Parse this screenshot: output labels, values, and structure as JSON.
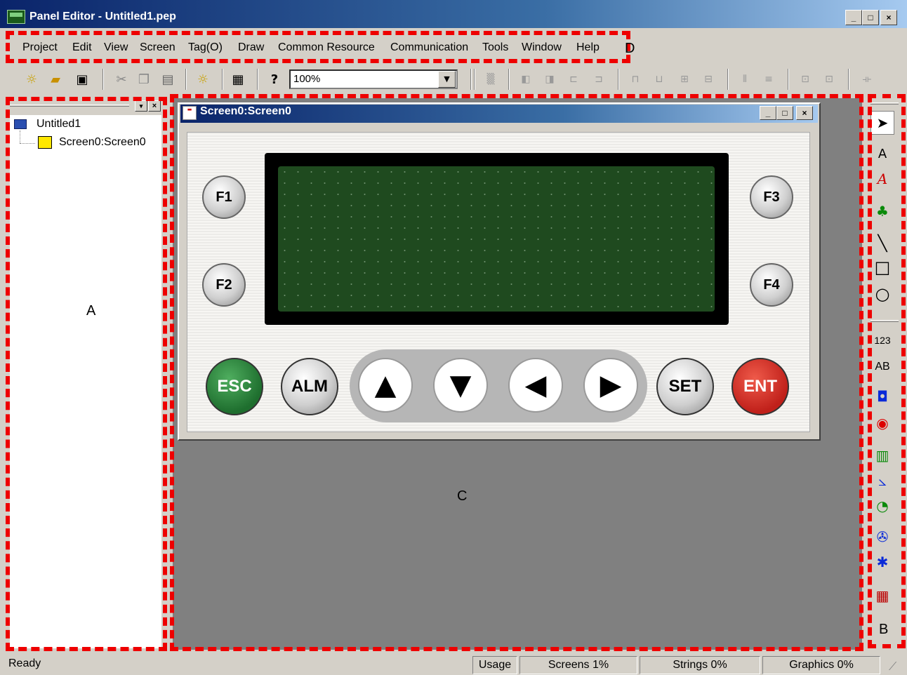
{
  "window": {
    "title": "Panel Editor - Untitled1.pep",
    "min": "_",
    "max": "□",
    "close": "×"
  },
  "menu": [
    "Project",
    "Edit",
    "View",
    "Screen",
    "Tag(O)",
    "Draw",
    "Common Resource",
    "Communication",
    "Tools",
    "Window",
    "Help"
  ],
  "toolbar": {
    "zoom": "100%",
    "icons": [
      "new-icon",
      "open-icon",
      "save-icon",
      "cut-icon",
      "copy-icon",
      "paste-icon",
      "new-screen-icon",
      "print-icon",
      "help-icon",
      "grid-icon",
      "bring-front-icon",
      "send-back-icon",
      "align-left-icon",
      "align-right-icon",
      "align-top-icon",
      "align-bottom-icon",
      "align-vcenter-icon",
      "align-hcenter-icon",
      "space-horizontal-icon",
      "space-vertical-icon",
      "center-horizontal-icon",
      "center-vertical-icon",
      "same-width-icon"
    ]
  },
  "tree": {
    "root": "Untitled1",
    "child": "Screen0:Screen0"
  },
  "child_window": {
    "title": "Screen0:Screen0"
  },
  "panel": {
    "fkeys": [
      "F1",
      "F2",
      "F3",
      "F4"
    ],
    "buttons": {
      "esc": "ESC",
      "alm": "ALM",
      "set": "SET",
      "ent": "ENT"
    },
    "arrows": {
      "up": "▲",
      "down": "▼",
      "left": "◀",
      "right": "▶"
    }
  },
  "toolbox": {
    "group1": [
      "pointer-icon",
      "text-icon",
      "italic-text-icon",
      "bitmap-icon",
      "line-icon",
      "rectangle-icon",
      "circle-icon"
    ],
    "group2_labels": {
      "numeric": "123",
      "text_display": "AB"
    },
    "group2": [
      "numeric-display-icon",
      "text-display-icon",
      "button-icon",
      "lamp-icon",
      "bar-graph-icon",
      "trend-icon",
      "pie-icon",
      "fan-icon",
      "windmill-icon",
      "calendar-icon"
    ]
  },
  "status": {
    "ready": "Ready",
    "usage": "Usage",
    "screens": "Screens  1%",
    "strings": "Strings  0%",
    "graphics": "Graphics  0%"
  },
  "annotations": {
    "a": "A",
    "b": "B",
    "c": "C",
    "d": "D"
  },
  "colors": {
    "title_start": "#0a246a",
    "title_end": "#a6caf0",
    "annotation": "#ee0000",
    "esc": "#1e6e2e",
    "ent": "#c0201a",
    "lcd": "#1f4a1f"
  }
}
